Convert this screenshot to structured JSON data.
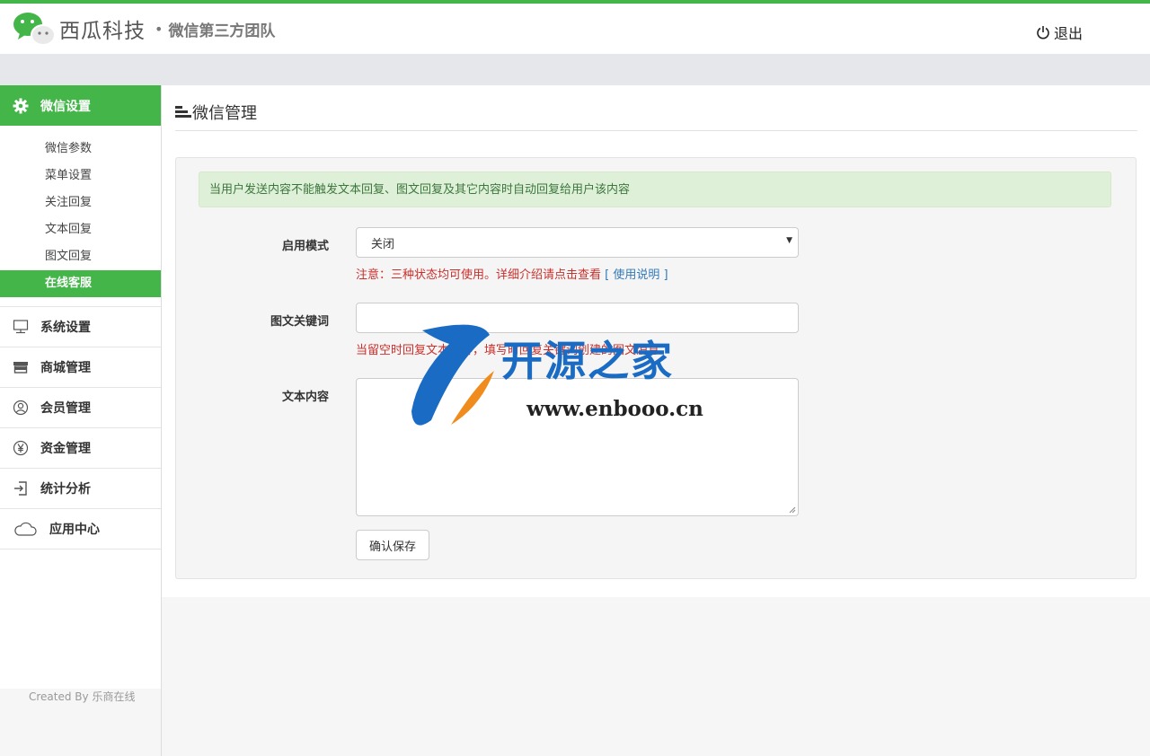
{
  "header": {
    "brand": "西瓜科技",
    "separator": "•",
    "tagline": "微信第三方团队",
    "logout_label": "退出"
  },
  "sidebar": {
    "active_section": "微信设置",
    "submenu": [
      "微信参数",
      "菜单设置",
      "关注回复",
      "文本回复",
      "图文回复",
      "在线客服"
    ],
    "active_submenu": "在线客服",
    "menu": [
      {
        "label": "系统设置",
        "icon": "monitor-icon"
      },
      {
        "label": "商城管理",
        "icon": "store-icon"
      },
      {
        "label": "会员管理",
        "icon": "user-circle-icon"
      },
      {
        "label": "资金管理",
        "icon": "yen-icon"
      },
      {
        "label": "统计分析",
        "icon": "login-icon"
      },
      {
        "label": "应用中心",
        "icon": "cloud-icon"
      }
    ],
    "footer": "Created By 乐商在线"
  },
  "main": {
    "title": "微信管理",
    "alert": "当用户发送内容不能触发文本回复、图文回复及其它内容时自动回复给用户该内容",
    "mode_label": "启用模式",
    "mode_value": "关闭",
    "mode_hint": "注意：三种状态均可使用。详细介绍请点击查看",
    "mode_hint_link": "[ 使用说明 ]",
    "keyword_label": "图文关键词",
    "keyword_value": "",
    "keyword_hint": "当留空时回复文本内容，填写时回复关键词创建的图文消息",
    "content_label": "文本内容",
    "content_value": "",
    "save_label": "确认保存"
  },
  "watermark": {
    "text": "开源之家",
    "url": "www.enbooo.cn"
  },
  "colors": {
    "accent": "#44b549",
    "alert_bg": "#dff0d8",
    "alert_text": "#3c763d",
    "hint_red": "#c9302c",
    "link": "#337ab7"
  }
}
